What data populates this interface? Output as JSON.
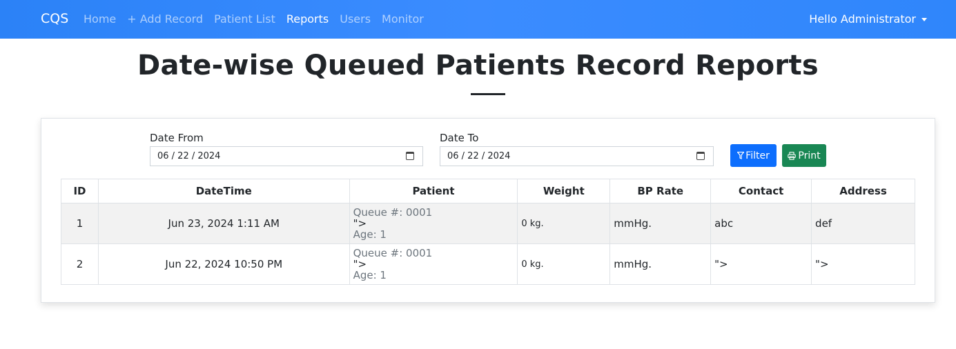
{
  "nav": {
    "brand": "CQS",
    "links": [
      "Home",
      "+ Add Record",
      "Patient List",
      "Reports",
      "Users",
      "Monitor"
    ],
    "active": "Reports",
    "user": "Hello Administrator"
  },
  "page": {
    "title": "Date-wise Queued Patients Record Reports"
  },
  "filters": {
    "from_label": "Date From",
    "from_value": "06 / 22 / 2024",
    "to_label": "Date To",
    "to_value": "06 / 22 / 2024",
    "filter_label": "Filter",
    "print_label": "Print"
  },
  "table": {
    "headers": [
      "ID",
      "DateTime",
      "Patient",
      "Weight",
      "BP Rate",
      "Contact",
      "Address"
    ],
    "rows": [
      {
        "id": "1",
        "datetime": "Jun 23, 2024 1:11 AM",
        "queue": "Queue #: 0001",
        "name": "\">",
        "age": "Age: 1",
        "weight": "0 kg.",
        "bp": "mmHg.",
        "contact": "abc",
        "address": "def"
      },
      {
        "id": "2",
        "datetime": "Jun 22, 2024 10:50 PM",
        "queue": "Queue #: 0001",
        "name": "\">",
        "age": "Age: 1",
        "weight": "0 kg.",
        "bp": "mmHg.",
        "contact": "\">",
        "address": "\">"
      }
    ]
  },
  "colors": {
    "navbar": "#2b82f7",
    "primary": "#0d6efd",
    "success": "#198754"
  }
}
